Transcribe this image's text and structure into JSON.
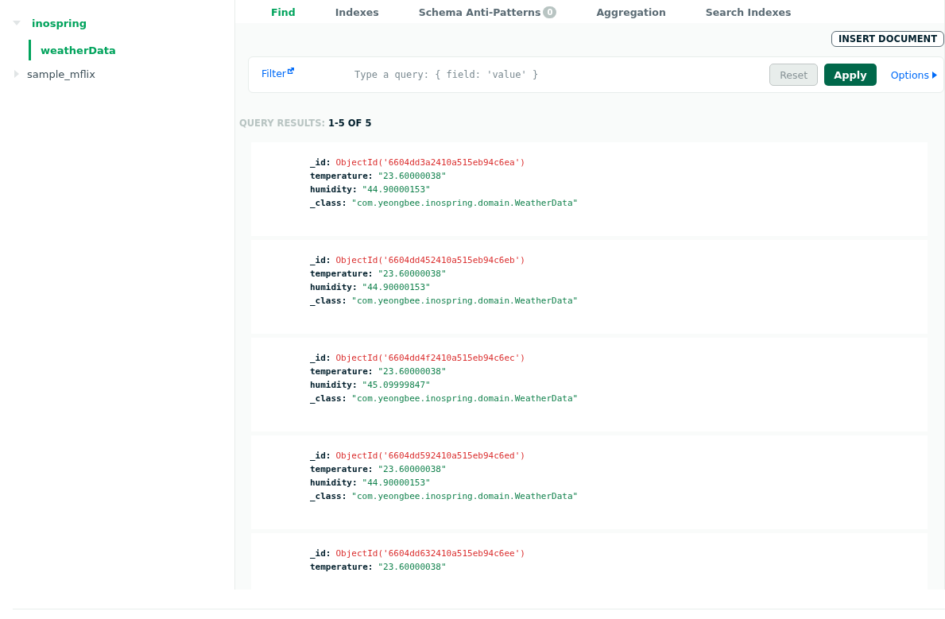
{
  "sidebar": {
    "databases": [
      {
        "name": "inospring",
        "expanded": true,
        "children": [
          {
            "name": "weatherData",
            "selected": true
          }
        ]
      },
      {
        "name": "sample_mflix",
        "expanded": false
      }
    ]
  },
  "tabs": [
    {
      "label": "Find",
      "selected": true
    },
    {
      "label": "Indexes",
      "selected": false
    },
    {
      "label": "Schema Anti-Patterns",
      "badge": "0",
      "selected": false
    },
    {
      "label": "Aggregation",
      "selected": false
    },
    {
      "label": "Search Indexes",
      "selected": false
    }
  ],
  "insert_button": "INSERT DOCUMENT",
  "query_bar": {
    "filter_label": "Filter",
    "placeholder": "Type a query: { field: 'value' }",
    "reset": "Reset",
    "apply": "Apply",
    "options": "Options"
  },
  "results": {
    "label": "QUERY RESULTS:",
    "count": "1-5 OF 5"
  },
  "documents": [
    {
      "fields": [
        {
          "key": "_id:",
          "value": "ObjectId('6604dd3a2410a515eb94c6ea')",
          "kind": "objectid"
        },
        {
          "key": "temperature:",
          "value": "\"23.60000038\"",
          "kind": "string"
        },
        {
          "key": "humidity:",
          "value": "\"44.90000153\"",
          "kind": "string"
        },
        {
          "key": "_class:",
          "value": "\"com.yeongbee.inospring.domain.WeatherData\"",
          "kind": "string"
        }
      ]
    },
    {
      "fields": [
        {
          "key": "_id:",
          "value": "ObjectId('6604dd452410a515eb94c6eb')",
          "kind": "objectid"
        },
        {
          "key": "temperature:",
          "value": "\"23.60000038\"",
          "kind": "string"
        },
        {
          "key": "humidity:",
          "value": "\"44.90000153\"",
          "kind": "string"
        },
        {
          "key": "_class:",
          "value": "\"com.yeongbee.inospring.domain.WeatherData\"",
          "kind": "string"
        }
      ]
    },
    {
      "fields": [
        {
          "key": "_id:",
          "value": "ObjectId('6604dd4f2410a515eb94c6ec')",
          "kind": "objectid"
        },
        {
          "key": "temperature:",
          "value": "\"23.60000038\"",
          "kind": "string"
        },
        {
          "key": "humidity:",
          "value": "\"45.09999847\"",
          "kind": "string"
        },
        {
          "key": "_class:",
          "value": "\"com.yeongbee.inospring.domain.WeatherData\"",
          "kind": "string"
        }
      ]
    },
    {
      "fields": [
        {
          "key": "_id:",
          "value": "ObjectId('6604dd592410a515eb94c6ed')",
          "kind": "objectid"
        },
        {
          "key": "temperature:",
          "value": "\"23.60000038\"",
          "kind": "string"
        },
        {
          "key": "humidity:",
          "value": "\"44.90000153\"",
          "kind": "string"
        },
        {
          "key": "_class:",
          "value": "\"com.yeongbee.inospring.domain.WeatherData\"",
          "kind": "string"
        }
      ]
    },
    {
      "fields": [
        {
          "key": "_id:",
          "value": "ObjectId('6604dd632410a515eb94c6ee')",
          "kind": "objectid"
        },
        {
          "key": "temperature:",
          "value": "\"23.60000038\"",
          "kind": "string"
        }
      ]
    }
  ]
}
